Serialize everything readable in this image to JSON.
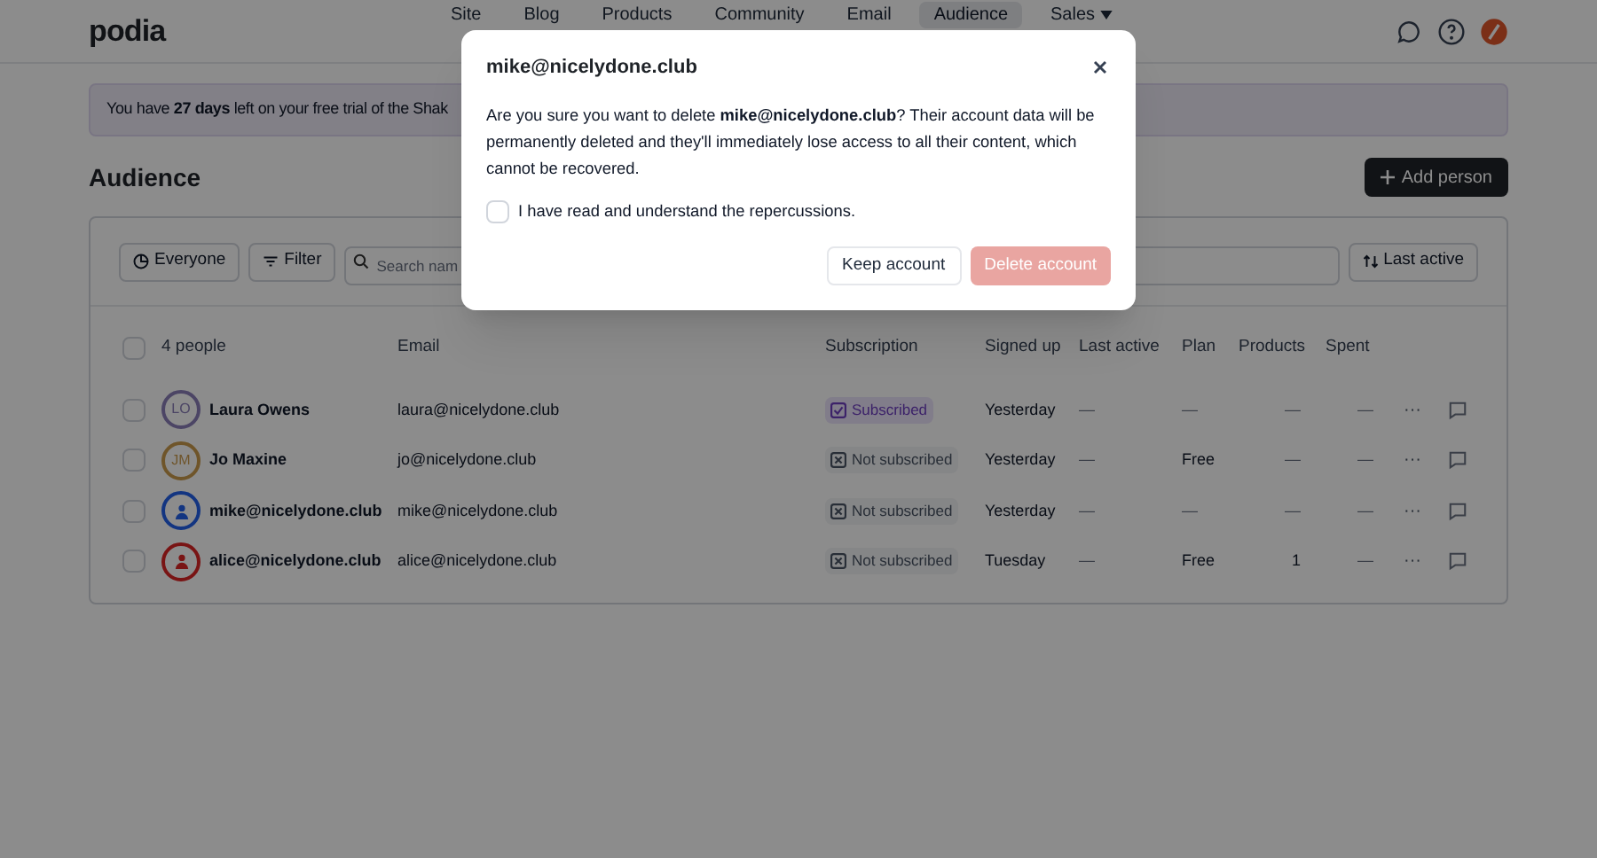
{
  "app": {
    "logo": "podia"
  },
  "nav": [
    {
      "label": "Site",
      "selected": false,
      "caret": false
    },
    {
      "label": "Blog",
      "selected": false,
      "caret": false
    },
    {
      "label": "Products",
      "selected": false,
      "caret": false
    },
    {
      "label": "Community",
      "selected": false,
      "caret": false
    },
    {
      "label": "Email",
      "selected": false,
      "caret": false
    },
    {
      "label": "Audience",
      "selected": true,
      "caret": false
    },
    {
      "label": "Sales",
      "selected": false,
      "caret": true
    }
  ],
  "trial_banner": "You have **27 days** left on your free trial of the Shak",
  "page_title": "Audience",
  "add_button": "Add person",
  "toolbar": {
    "segment": "Everyone",
    "filter": "Filter",
    "search_placeholder": "Search nam",
    "sort": "Last active"
  },
  "table": {
    "select_all_checked": false,
    "columns": [
      "4 people",
      "Email",
      "Subscription",
      "Signed up",
      "Last active",
      "Plan",
      "Products",
      "Spent"
    ],
    "rows": [
      {
        "checked": false,
        "name": "Laura Owens",
        "avatar": {
          "kind": "initials",
          "text": "LO",
          "color": "#4c4665"
        },
        "email": "laura@nicelydone.club",
        "subscription": "Subscribed",
        "subscribed": true,
        "signed_up": "Yesterday",
        "last_active": "—",
        "plan": "—",
        "products": "—",
        "spent": "—",
        "actions": "···"
      },
      {
        "checked": false,
        "name": "Jo Maxine",
        "avatar": {
          "kind": "initials",
          "text": "JM",
          "color": "#6f552b"
        },
        "email": "jo@nicelydone.club",
        "subscription": "Not subscribed",
        "subscribed": false,
        "signed_up": "Yesterday",
        "last_active": "—",
        "plan": "Free",
        "products": "—",
        "spent": "—",
        "actions": "···"
      },
      {
        "checked": false,
        "name": "mike@nicelydone.club",
        "avatar": {
          "kind": "person",
          "color": "#143681"
        },
        "email": "mike@nicelydone.club",
        "subscription": "Not subscribed",
        "subscribed": false,
        "signed_up": "Yesterday",
        "last_active": "—",
        "plan": "—",
        "products": "—",
        "spent": "—",
        "actions": "···"
      },
      {
        "checked": false,
        "name": "alice@nicelydone.club",
        "avatar": {
          "kind": "person",
          "color": "#791515"
        },
        "email": "alice@nicelydone.club",
        "subscription": "Not subscribed",
        "subscribed": false,
        "signed_up": "Tuesday",
        "last_active": "—",
        "plan": "Free",
        "products": "1",
        "spent": "—",
        "actions": "···"
      }
    ]
  },
  "dialog": {
    "title": "mike@nicelydone.club",
    "message": "Are you sure you want to delete **mike@nicelydone.club**? Their account data will be permanently deleted and they'll immediately lose access to all their content, which cannot be recovered.",
    "confirm_checkbox": {
      "label": "I have read and understand the repercussions.",
      "checked": false
    },
    "keep_button": "Keep account",
    "delete_button": {
      "label": "Delete account",
      "disabled": true
    }
  }
}
